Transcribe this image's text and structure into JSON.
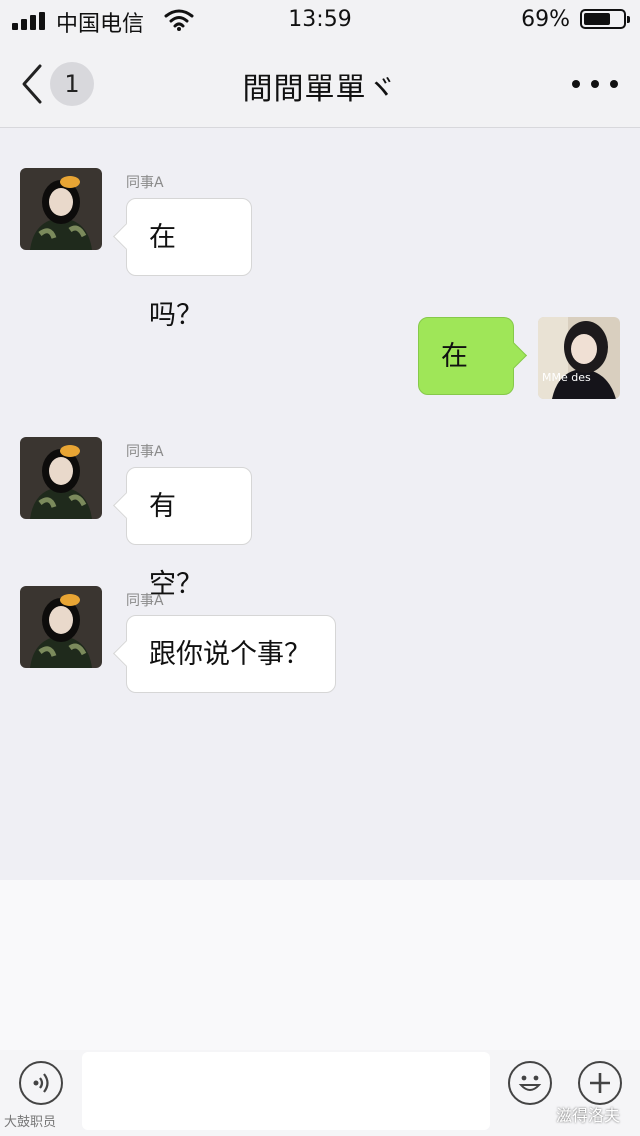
{
  "status_bar": {
    "carrier": "中国电信",
    "time": "13:59",
    "battery_percent": "69%",
    "battery_level": 0.69
  },
  "nav": {
    "back_icon": "chevron-left-icon",
    "unread_count": "1",
    "title": "間間單單ヾ",
    "more_icon": "more-dots-icon"
  },
  "messages": [
    {
      "direction": "in",
      "sender": "同事A",
      "text": "在吗？"
    },
    {
      "direction": "out",
      "text": "在"
    },
    {
      "direction": "in",
      "sender": "同事A",
      "text": "有空？"
    },
    {
      "direction": "in",
      "sender": "同事A",
      "text": "跟你说个事？"
    }
  ],
  "input_bar": {
    "voice_icon": "voice-icon",
    "emoji_icon": "emoji-icon",
    "plus_icon": "plus-icon",
    "text_value": ""
  },
  "watermarks": {
    "left": "大鼓职员",
    "right": "滋得洛夫"
  },
  "colors": {
    "background": "#efeff4",
    "outgoing_bubble": "#9fe658",
    "incoming_bubble": "#ffffff"
  }
}
